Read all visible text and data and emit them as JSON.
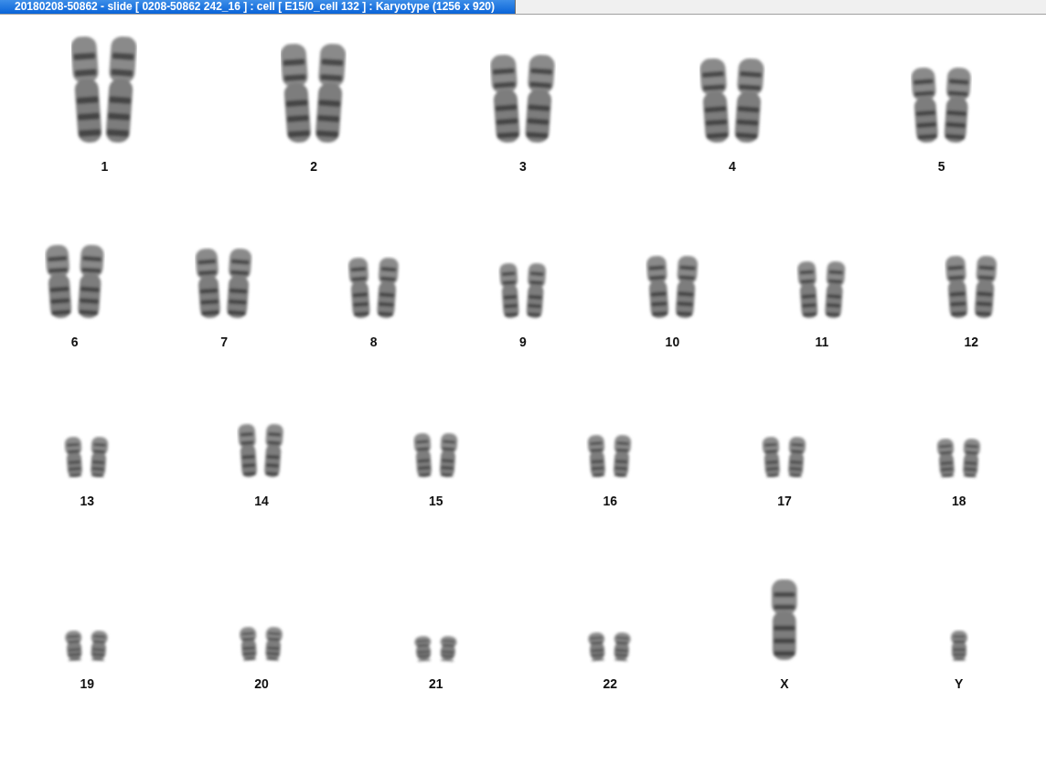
{
  "window": {
    "title": "20180208-50862 - slide [ 0208-50862 242_16 ] : cell [ E15/0_cell 132 ] : Karyotype  (1256 x 920)"
  },
  "karyotype": {
    "rows": [
      {
        "chromosomes": [
          {
            "label": "1",
            "kind": "pair"
          },
          {
            "label": "2",
            "kind": "pair"
          },
          {
            "label": "3",
            "kind": "pair"
          },
          {
            "label": "4",
            "kind": "pair"
          },
          {
            "label": "5",
            "kind": "pair"
          }
        ]
      },
      {
        "chromosomes": [
          {
            "label": "6",
            "kind": "pair"
          },
          {
            "label": "7",
            "kind": "pair"
          },
          {
            "label": "8",
            "kind": "pair"
          },
          {
            "label": "9",
            "kind": "pair"
          },
          {
            "label": "10",
            "kind": "pair"
          },
          {
            "label": "11",
            "kind": "pair"
          },
          {
            "label": "12",
            "kind": "pair"
          }
        ]
      },
      {
        "chromosomes": [
          {
            "label": "13",
            "kind": "pair"
          },
          {
            "label": "14",
            "kind": "pair"
          },
          {
            "label": "15",
            "kind": "pair"
          },
          {
            "label": "16",
            "kind": "pair"
          },
          {
            "label": "17",
            "kind": "pair"
          },
          {
            "label": "18",
            "kind": "pair"
          }
        ]
      },
      {
        "chromosomes": [
          {
            "label": "19",
            "kind": "pair"
          },
          {
            "label": "20",
            "kind": "pair"
          },
          {
            "label": "21",
            "kind": "pair"
          },
          {
            "label": "22",
            "kind": "pair"
          },
          {
            "label": "X",
            "kind": "single"
          },
          {
            "label": "Y",
            "kind": "single"
          }
        ]
      }
    ]
  }
}
